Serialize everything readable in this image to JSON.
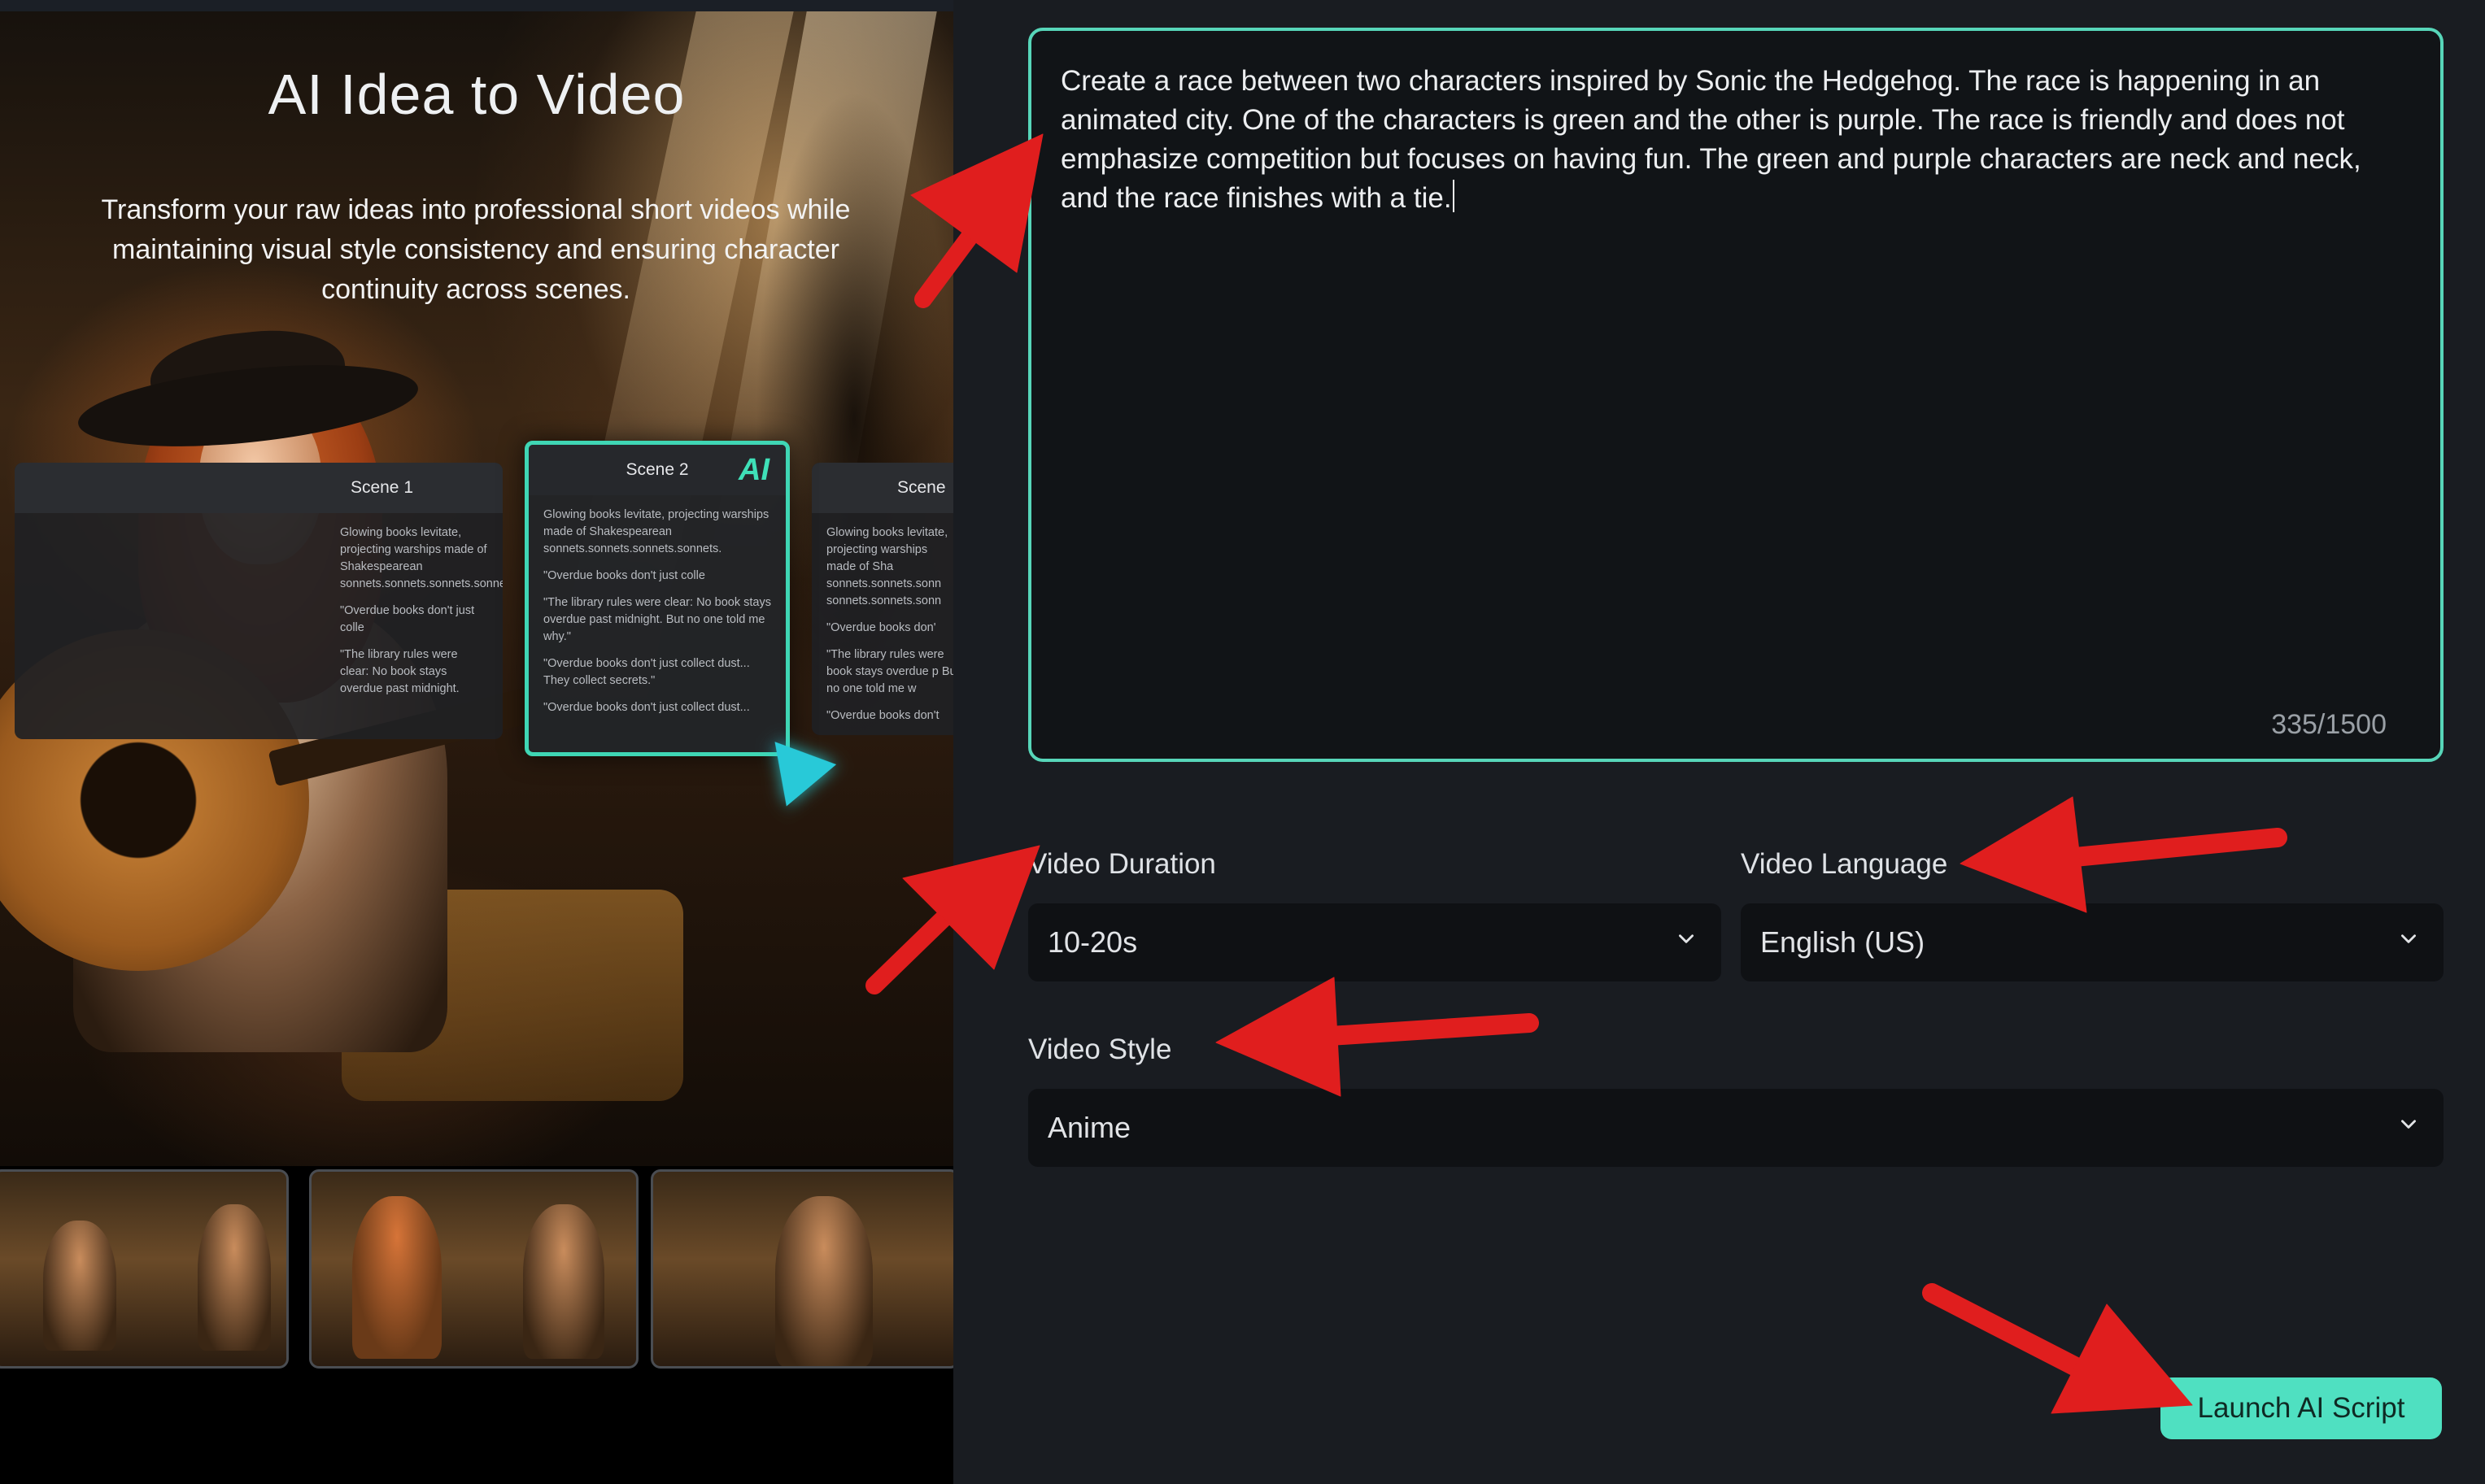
{
  "promo": {
    "title": "AI Idea to Video",
    "subtitle": "Transform your raw ideas into professional short videos while maintaining visual style consistency and ensuring character continuity across scenes.",
    "cards": {
      "left": {
        "title": "Scene 1",
        "lines": [
          "Glowing books levitate, projecting warships made of Shakespearean sonnets.sonnets.sonnets.sonnets.",
          "\"Overdue books don't just colle",
          "\"The library rules were clear: No book stays overdue past midnight."
        ]
      },
      "main": {
        "title": "Scene 2",
        "badge": "AI",
        "lines": [
          "Glowing books levitate, projecting warships made of Shakespearean sonnets.sonnets.sonnets.sonnets.",
          "\"Overdue books don't just colle",
          "\"The library rules were clear: No book stays overdue past midnight. But no one told me why.\"",
          "\"Overdue books don't just collect dust... They collect secrets.\"",
          "\"Overdue books don't just collect dust..."
        ]
      },
      "right": {
        "title": "Scene",
        "lines": [
          "Glowing books levitate, projecting warships made of Sha sonnets.sonnets.sonn sonnets.sonnets.sonn",
          "\"Overdue books don'",
          "\"The library rules were book stays overdue p But no one told me w",
          "\"Overdue books don't"
        ]
      }
    }
  },
  "form": {
    "prompt": {
      "text": "Create a race between two characters inspired by Sonic the Hedgehog. The race is happening in an animated city. One of the characters is green and the other is purple. The race is friendly and does not emphasize competition but focuses on having fun. The green and purple characters are neck and neck, and the race finishes with a tie.",
      "counter": "335/1500"
    },
    "duration": {
      "label": "Video Duration",
      "value": "10-20s"
    },
    "language": {
      "label": "Video Language",
      "value": "English (US)"
    },
    "style": {
      "label": "Video Style",
      "value": "Anime"
    },
    "launch_label": "Launch AI Script"
  },
  "colors": {
    "accent": "#4fe0c1",
    "panel_bg": "#191c21",
    "field_bg": "#0f1114",
    "arrow_red": "#e01e1e"
  }
}
